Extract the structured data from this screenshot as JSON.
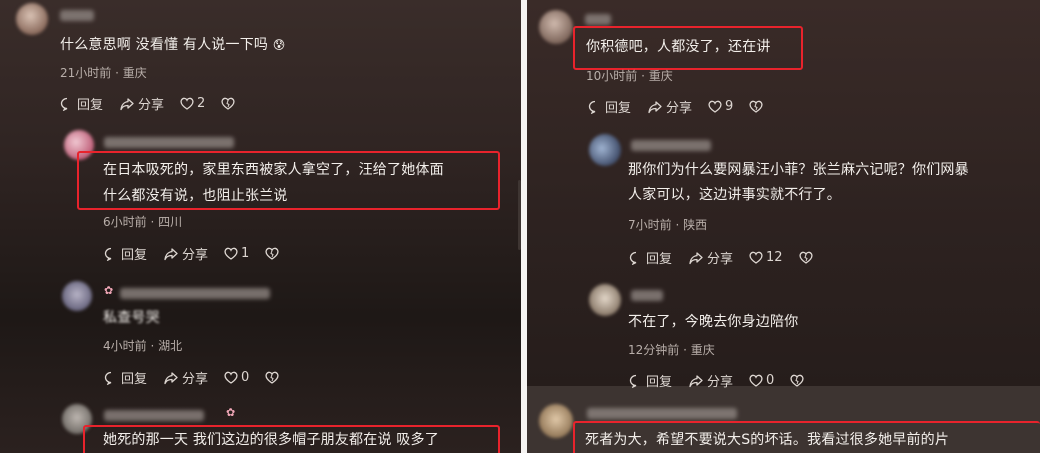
{
  "left": {
    "comments": [
      {
        "text": "什么意思啊 没看懂 有人说一下吗",
        "emoji": "😰",
        "time": "21小时前",
        "location": "重庆",
        "reply": "回复",
        "share": "分享",
        "likes": "2"
      },
      {
        "lines": [
          "在日本吸死的，家里东西被家人拿空了，汪给了她体面",
          "什么都没有说，也阻止张兰说"
        ],
        "time": "6小时前",
        "location": "四川",
        "reply": "回复",
        "share": "分享",
        "likes": "1"
      },
      {
        "text": "私查号哭",
        "time": "4小时前",
        "location": "湖北",
        "reply": "回复",
        "share": "分享",
        "likes": "0"
      },
      {
        "text": "她死的那一天 我们这边的很多帽子朋友都在说 吸多了"
      }
    ]
  },
  "right": {
    "comments": [
      {
        "text": "你积德吧，人都没了，还在讲",
        "time": "10小时前",
        "location": "重庆",
        "reply": "回复",
        "share": "分享",
        "likes": "9"
      },
      {
        "lines": [
          "那你们为什么要网暴汪小菲？张兰麻六记呢？你们网暴",
          "人家可以，这边讲事实就不行了。"
        ],
        "time": "7小时前",
        "location": "陕西",
        "reply": "回复",
        "share": "分享",
        "likes": "12"
      },
      {
        "text": "不在了，今晚去你身边陪你",
        "time": "12分钟前",
        "location": "重庆",
        "reply": "回复",
        "share": "分享",
        "likes": "0"
      },
      {
        "text": "死者为大，希望不要说大S的坏话。我看过很多她早前的片"
      }
    ]
  },
  "meta_separator": "·",
  "colors": {
    "highlight": "#e8232c",
    "text": "#f3efeb",
    "meta": "#b8aea9"
  }
}
